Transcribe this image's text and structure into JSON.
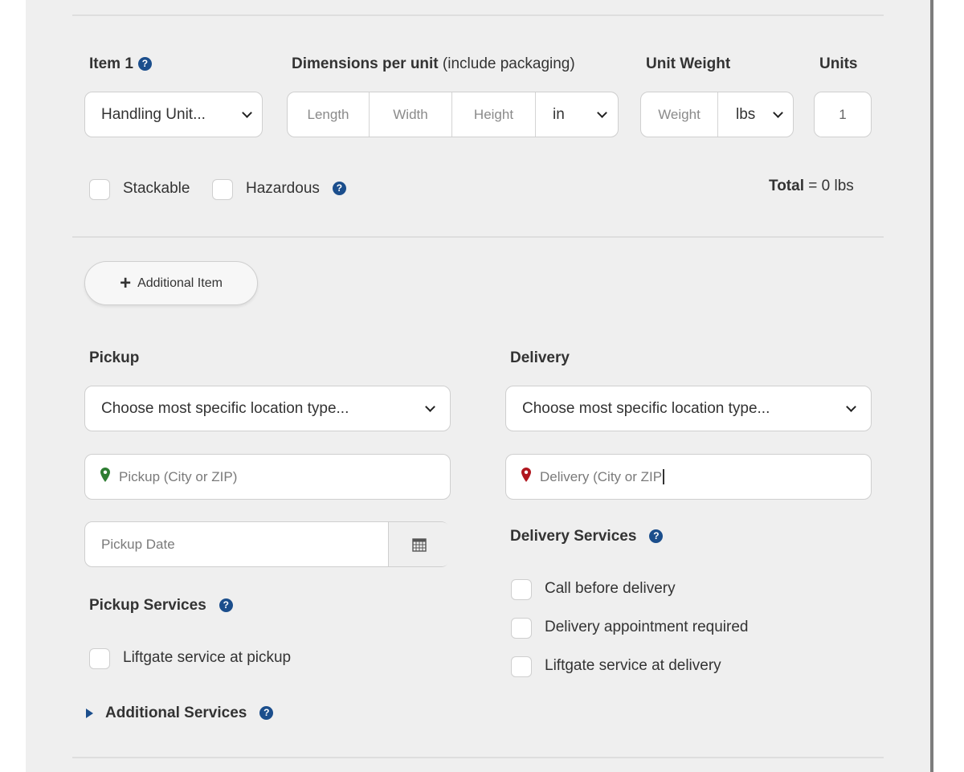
{
  "item": {
    "label": "Item 1",
    "dimensions_label": "Dimensions per unit",
    "dimensions_note": "(include packaging)",
    "unit_weight_label": "Unit Weight",
    "units_label": "Units",
    "type_select": "Handling Unit...",
    "length_placeholder": "Length",
    "width_placeholder": "Width",
    "height_placeholder": "Height",
    "dim_unit": "in",
    "weight_placeholder": "Weight",
    "weight_unit": "lbs",
    "units_value": "1",
    "stackable_label": "Stackable",
    "hazardous_label": "Hazardous",
    "total_label": "Total",
    "total_eq": "=",
    "total_value": "0 lbs"
  },
  "additional_item_label": "Additional Item",
  "pickup": {
    "title": "Pickup",
    "location_type": "Choose most specific location type...",
    "city_placeholder": "Pickup (City or ZIP)",
    "date_placeholder": "Pickup Date",
    "services_title": "Pickup Services",
    "services": [
      "Liftgate service at pickup"
    ],
    "additional_services": "Additional Services"
  },
  "delivery": {
    "title": "Delivery",
    "location_type": "Choose most specific location type...",
    "city_value": "Delivery (City or ZIP",
    "services_title": "Delivery Services",
    "services": [
      "Call before delivery",
      "Delivery appointment required",
      "Liftgate service at delivery"
    ]
  },
  "icons": {
    "help": "?",
    "plus": "+",
    "pickup_pin_color": "#2e7d32",
    "delivery_pin_color": "#b0171f",
    "help_color": "#1b4e8c"
  }
}
